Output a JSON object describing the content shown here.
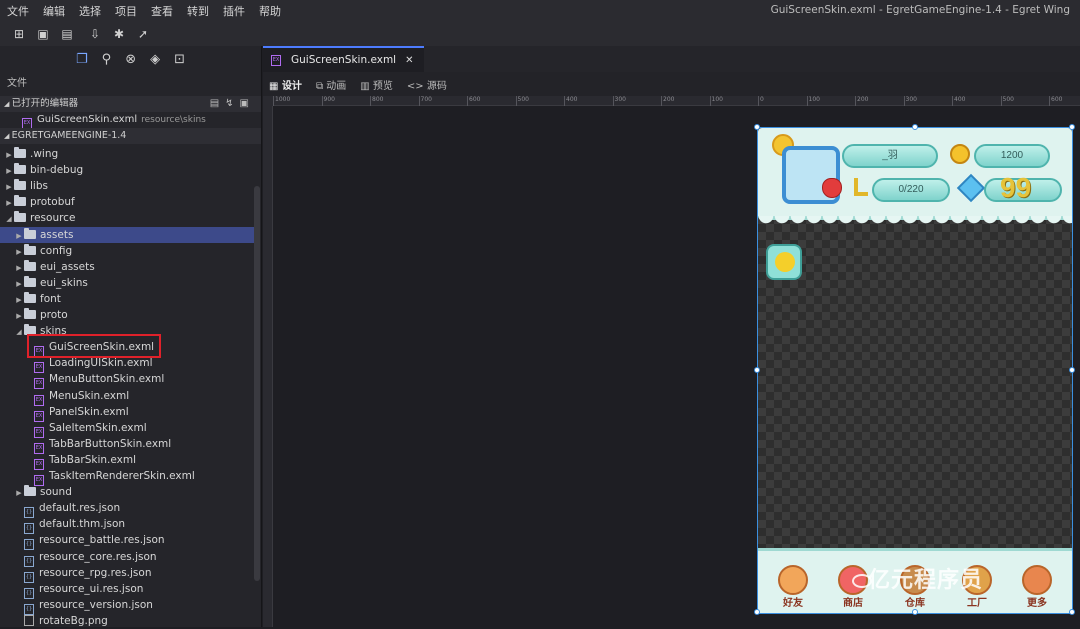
{
  "menubar": {
    "items": [
      "文件",
      "编辑",
      "选择",
      "项目",
      "查看",
      "转到",
      "插件",
      "帮助"
    ],
    "window_title": "GuiScreenSkin.exml - EgretGameEngine-1.4 - Egret Wing"
  },
  "sidebar": {
    "caption": "文件",
    "open_editors_label": "已打开的编辑器",
    "open_file_name": "GuiScreenSkin.exml",
    "open_file_path": "resource\\skins",
    "project_label": "EGRETGAMEENGINE-1.4",
    "tree": [
      {
        "label": ".wing",
        "type": "folder",
        "depth": 1,
        "arrow": "▶"
      },
      {
        "label": "bin-debug",
        "type": "folder",
        "depth": 1,
        "arrow": "▶"
      },
      {
        "label": "libs",
        "type": "folder",
        "depth": 1,
        "arrow": "▶"
      },
      {
        "label": "protobuf",
        "type": "folder",
        "depth": 1,
        "arrow": "▶"
      },
      {
        "label": "resource",
        "type": "folder",
        "depth": 1,
        "arrow": "◢"
      },
      {
        "label": "assets",
        "type": "folder",
        "depth": 2,
        "arrow": "▶",
        "selected": true
      },
      {
        "label": "config",
        "type": "folder",
        "depth": 2,
        "arrow": "▶"
      },
      {
        "label": "eui_assets",
        "type": "folder",
        "depth": 2,
        "arrow": "▶"
      },
      {
        "label": "eui_skins",
        "type": "folder",
        "depth": 2,
        "arrow": "▶"
      },
      {
        "label": "font",
        "type": "folder",
        "depth": 2,
        "arrow": "▶"
      },
      {
        "label": "proto",
        "type": "folder",
        "depth": 2,
        "arrow": "▶"
      },
      {
        "label": "skins",
        "type": "folder",
        "depth": 2,
        "arrow": "◢"
      },
      {
        "label": "GuiScreenSkin.exml",
        "type": "exml",
        "depth": 3
      },
      {
        "label": "LoadingUISkin.exml",
        "type": "exml",
        "depth": 3
      },
      {
        "label": "MenuButtonSkin.exml",
        "type": "exml",
        "depth": 3
      },
      {
        "label": "MenuSkin.exml",
        "type": "exml",
        "depth": 3
      },
      {
        "label": "PanelSkin.exml",
        "type": "exml",
        "depth": 3
      },
      {
        "label": "SaleItemSkin.exml",
        "type": "exml",
        "depth": 3
      },
      {
        "label": "TabBarButtonSkin.exml",
        "type": "exml",
        "depth": 3
      },
      {
        "label": "TabBarSkin.exml",
        "type": "exml",
        "depth": 3
      },
      {
        "label": "TaskItemRendererSkin.exml",
        "type": "exml",
        "depth": 3
      },
      {
        "label": "sound",
        "type": "folder",
        "depth": 2,
        "arrow": "▶"
      },
      {
        "label": "default.res.json",
        "type": "json",
        "depth": 2
      },
      {
        "label": "default.thm.json",
        "type": "json",
        "depth": 2
      },
      {
        "label": "resource_battle.res.json",
        "type": "json",
        "depth": 2
      },
      {
        "label": "resource_core.res.json",
        "type": "json",
        "depth": 2
      },
      {
        "label": "resource_rpg.res.json",
        "type": "json",
        "depth": 2
      },
      {
        "label": "resource_ui.res.json",
        "type": "json",
        "depth": 2
      },
      {
        "label": "resource_version.json",
        "type": "json",
        "depth": 2
      },
      {
        "label": "rotateBg.png",
        "type": "png",
        "depth": 2
      }
    ]
  },
  "editor": {
    "tab_label": "GuiScreenSkin.exml",
    "modes": [
      "设计",
      "动画",
      "预览",
      "源码"
    ],
    "ruler_ticks": [
      "1000",
      "900",
      "800",
      "700",
      "600",
      "500",
      "400",
      "300",
      "200",
      "100",
      "0",
      "100",
      "200",
      "300",
      "400",
      "500",
      "600"
    ]
  },
  "game": {
    "name_label": "_羽",
    "gold": "1200",
    "exp": "0/220",
    "gems": "99",
    "bottom_buttons": [
      "好友",
      "商店",
      "仓库",
      "工厂",
      "更多"
    ]
  },
  "watermark": "亿元程序员",
  "colors": {
    "accent": "#4d7cff",
    "selection": "#3d4a8a",
    "highlight_box": "#e0212a"
  }
}
